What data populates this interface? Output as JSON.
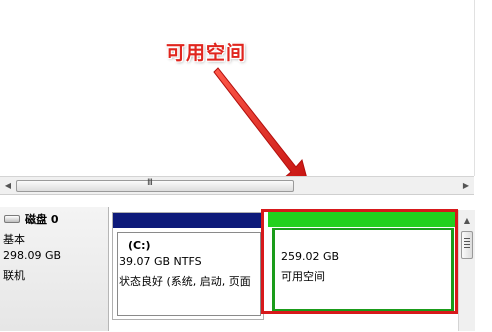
{
  "annotation": {
    "text": "可用空间",
    "color": "#e0251e"
  },
  "scrollbar": {
    "grip": "III",
    "left_icon": "left-arrow-icon",
    "right_icon": "right-arrow-icon"
  },
  "disk": {
    "name": "磁盘 0",
    "type": "基本",
    "size": "298.09 GB",
    "status": "联机",
    "icon": "disk-icon"
  },
  "partitions": [
    {
      "name": "(C:)",
      "size_fs": "39.07 GB NTFS",
      "status": "状态良好 (系统, 启动, 页面",
      "bar_color": "#0d1a7a"
    },
    {
      "size": "259.02 GB",
      "status": "可用空间",
      "bar_color": "#22d11e"
    }
  ],
  "highlight_color": "#d7191b"
}
